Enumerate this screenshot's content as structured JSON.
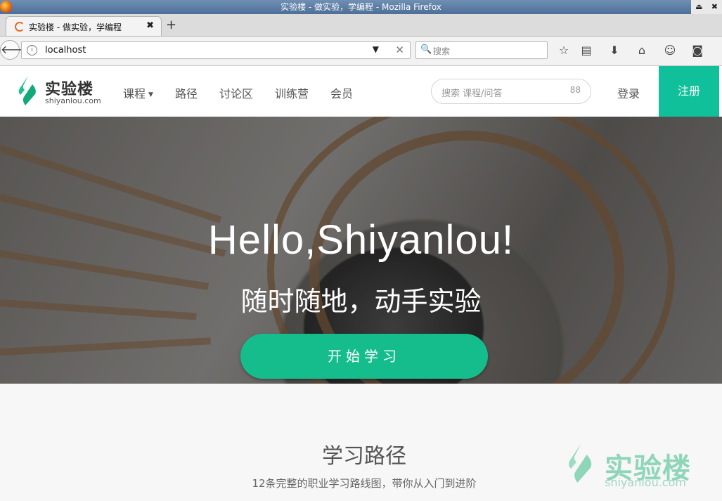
{
  "window": {
    "title": "实验楼 - 做实验，学编程 - Mozilla Firefox"
  },
  "tabs": [
    {
      "title": "实验楼 - 做实验，学编程",
      "close": "✖"
    }
  ],
  "newtab": "+",
  "navbar": {
    "url": "localhost",
    "search_placeholder": "搜索"
  },
  "site": {
    "logo_cn": "实验楼",
    "logo_en": "shiyanlou.com",
    "menu": [
      {
        "label": "课程"
      },
      {
        "label": "路径"
      },
      {
        "label": "讨论区"
      },
      {
        "label": "训练营"
      },
      {
        "label": "会员"
      }
    ],
    "search_placeholder": "搜索 课程/问答",
    "login": "登录",
    "register": "注册",
    "accent": "#0fc09a"
  },
  "hero": {
    "title": "Hello,Shiyanlou!",
    "subtitle": "随时随地，动手实验",
    "button": "开始学习"
  },
  "section": {
    "title": "学习路径",
    "desc": "12条完整的职业学习路线图，带你从入门到进阶"
  },
  "watermark": {
    "cn": "实验楼",
    "en": "shiyanlou.com"
  }
}
